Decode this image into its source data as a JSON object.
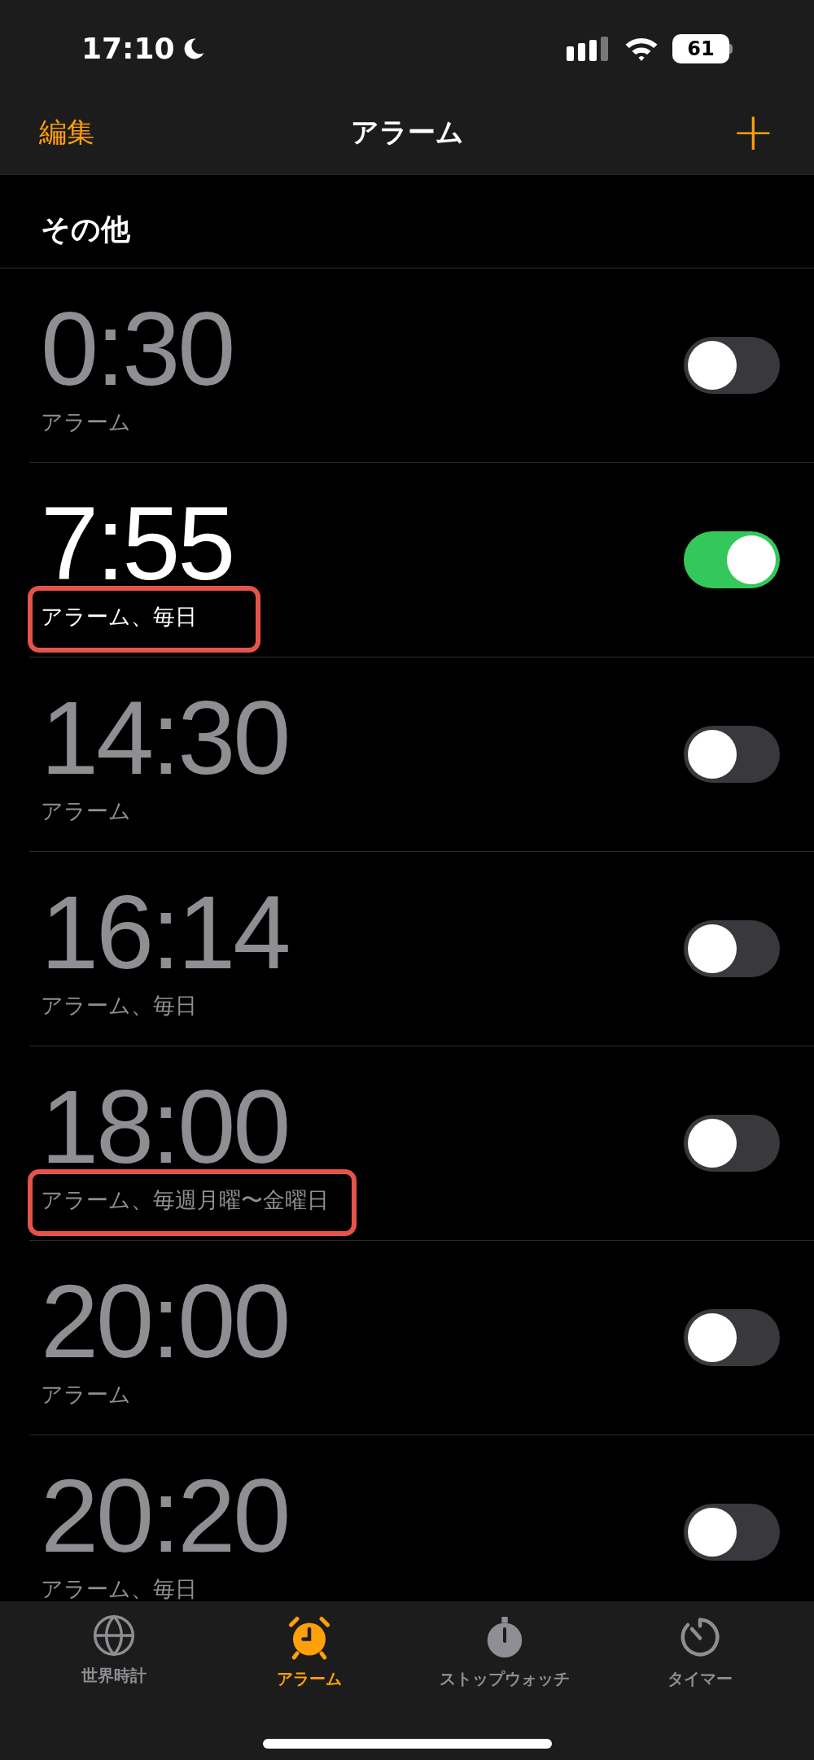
{
  "status_bar": {
    "time": "17:10",
    "battery": "61"
  },
  "nav": {
    "edit": "編集",
    "title": "アラーム",
    "add": "+"
  },
  "section": "その他",
  "alarms": [
    {
      "time": "0:30",
      "label": "アラーム",
      "on": false,
      "highlighted": false
    },
    {
      "time": "7:55",
      "label": "アラーム、毎日",
      "on": true,
      "highlighted": true
    },
    {
      "time": "14:30",
      "label": "アラーム",
      "on": false,
      "highlighted": false
    },
    {
      "time": "16:14",
      "label": "アラーム、毎日",
      "on": false,
      "highlighted": false
    },
    {
      "time": "18:00",
      "label": "アラーム、毎週月曜〜金曜日",
      "on": false,
      "highlighted": true
    },
    {
      "time": "20:00",
      "label": "アラーム",
      "on": false,
      "highlighted": false
    },
    {
      "time": "20:20",
      "label": "アラーム、毎日",
      "on": false,
      "highlighted": false
    }
  ],
  "tabs": [
    {
      "kind": "world",
      "label": "世界時計",
      "selected": false
    },
    {
      "kind": "alarm",
      "label": "アラーム",
      "selected": true
    },
    {
      "kind": "stopwatch",
      "label": "ストップウォッチ",
      "selected": false
    },
    {
      "kind": "timer",
      "label": "タイマー",
      "selected": false
    }
  ]
}
